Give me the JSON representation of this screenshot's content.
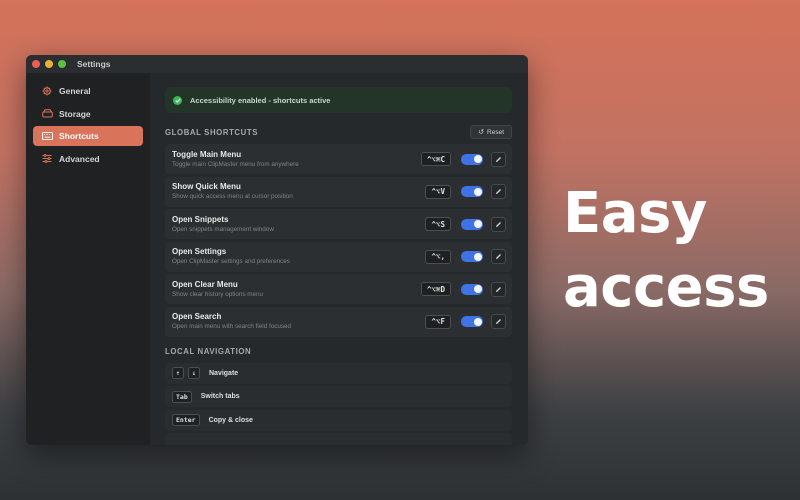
{
  "window": {
    "title": "Settings"
  },
  "sidebar": {
    "items": [
      {
        "label": "General",
        "icon": "gear-icon"
      },
      {
        "label": "Storage",
        "icon": "drive-icon"
      },
      {
        "label": "Shortcuts",
        "icon": "keyboard-icon",
        "active": true
      },
      {
        "label": "Advanced",
        "icon": "sliders-icon"
      }
    ]
  },
  "banner": {
    "text": "Accessibility enabled - shortcuts active",
    "icon": "check-circle-icon",
    "color": "#3ab95a"
  },
  "global_shortcuts": {
    "title": "GLOBAL SHORTCUTS",
    "reset_label": "Reset",
    "items": [
      {
        "title": "Toggle Main Menu",
        "desc": "Toggle main ClipMaster menu from anywhere",
        "keys": "^⌥⌘C",
        "enabled": true
      },
      {
        "title": "Show Quick Menu",
        "desc": "Show quick access menu at cursor position",
        "keys": "^⌥V",
        "enabled": true
      },
      {
        "title": "Open Snippets",
        "desc": "Open snippets management window",
        "keys": "^⌥S",
        "enabled": true
      },
      {
        "title": "Open Settings",
        "desc": "Open ClipMaster settings and preferences",
        "keys": "^⌥,",
        "enabled": true
      },
      {
        "title": "Open Clear Menu",
        "desc": "Show clear history options menu",
        "keys": "^⌥⌘D",
        "enabled": true
      },
      {
        "title": "Open Search",
        "desc": "Open main menu with search field focused",
        "keys": "^⌥F",
        "enabled": true
      }
    ]
  },
  "local_navigation": {
    "title": "LOCAL NAVIGATION",
    "items": [
      {
        "keys": [
          "↑",
          "↓"
        ],
        "label": "Navigate"
      },
      {
        "keys": [
          "Tab"
        ],
        "label": "Switch tabs"
      },
      {
        "keys": [
          "Enter"
        ],
        "label": "Copy & close"
      }
    ]
  },
  "headline": {
    "line1": "Easy",
    "line2": "access"
  },
  "colors": {
    "accent": "#d9735a",
    "toggle_on": "#3f73e6"
  }
}
